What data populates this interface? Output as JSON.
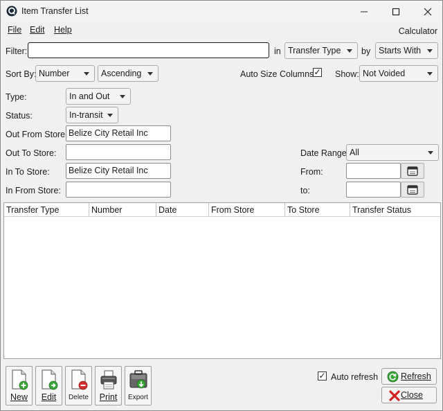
{
  "window": {
    "title": "Item Transfer List"
  },
  "menu": {
    "file": "File",
    "edit": "Edit",
    "help": "Help",
    "calculator": "Calculator"
  },
  "filter": {
    "label": "Filter:",
    "value": "",
    "in_label": "in",
    "field": "Transfer Type",
    "by_label": "by",
    "match": "Starts With"
  },
  "sort": {
    "label": "Sort By:",
    "field": "Number",
    "order": "Ascending",
    "auto_size_label": "Auto Size Columns",
    "auto_size_checked": true,
    "show_label": "Show:",
    "show_value": "Not Voided"
  },
  "type": {
    "label": "Type:",
    "value": "In and Out"
  },
  "status": {
    "label": "Status:",
    "value": "In-transit"
  },
  "stores": {
    "out_from_label": "Out From Store:",
    "out_from_value": "Belize City Retail Inc",
    "out_to_label": "Out To Store:",
    "out_to_value": "",
    "in_to_label": "In To Store:",
    "in_to_value": "Belize City Retail Inc",
    "in_from_label": "In From Store:",
    "in_from_value": ""
  },
  "date": {
    "range_label": "Date Range:",
    "range_value": "All",
    "from_label": "From:",
    "from_value": "",
    "to_label": "to:",
    "to_value": ""
  },
  "grid": {
    "columns": [
      "Transfer Type",
      "Number",
      "Date",
      "From Store",
      "To Store",
      "Transfer Status"
    ]
  },
  "toolbar": {
    "new": "New",
    "edit": "Edit",
    "delete": "Delete",
    "print": "Print",
    "export": "Export"
  },
  "footer": {
    "auto_refresh_label": "Auto refresh",
    "auto_refresh_checked": true,
    "refresh": "Refresh",
    "close": "Close"
  }
}
